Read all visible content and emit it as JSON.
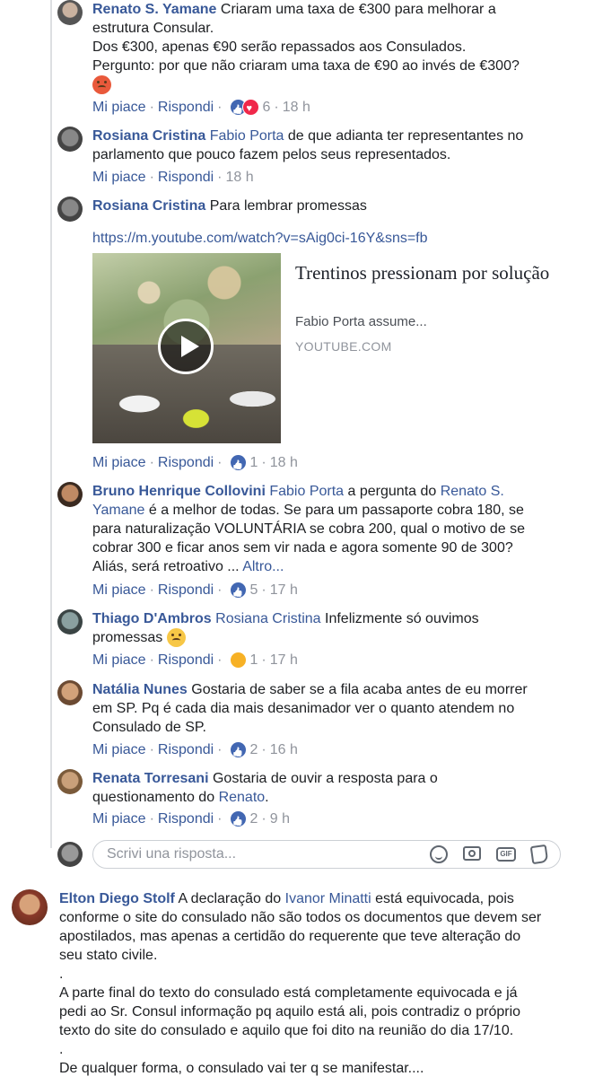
{
  "labels": {
    "like": "Mi piace",
    "reply": "Rispondi",
    "sep": "·"
  },
  "comments": [
    {
      "name": "Renato S. Yamane",
      "lines": [
        "Criaram uma taxa de €300 para melhorar a",
        "estrutura Consular.",
        "Dos €300, apenas €90 serão repassados aos Consulados.",
        "Pergunto: por que não criaram uma taxa de €90 ao invés de €300?"
      ],
      "count": "6",
      "time": "18 h"
    },
    {
      "name": "Rosiana Cristina",
      "mention": "Fabio Porta",
      "lines": [
        "de que adianta ter representantes no",
        "parlamento que pouco fazem pelos seus representados."
      ],
      "time": "18 h"
    },
    {
      "name": "Rosiana Cristina",
      "text": "Para lembrar promessas",
      "url": "https://m.youtube.com/watch?v=sAig0ci-16Y&sns=fb",
      "preview": {
        "title": "Trentinos pressionam por solução",
        "desc": "Fabio Porta assume...",
        "source": "YOUTUBE.COM"
      },
      "count": "1",
      "time": "18 h"
    },
    {
      "name": "Bruno Henrique Collovini",
      "mention": "Fabio Porta",
      "text1": "a pergunta do",
      "mention2": "Renato S.",
      "mention2b": "Yamane",
      "lines": [
        "é a melhor de todas. Se para um passaporte cobra 180, se",
        "para naturalização VOLUNTÁRIA se cobra 200, qual o motivo de se",
        "cobrar 300 e ficar anos sem vir nada e agora somente 90 de 300?",
        "Aliás, será retroativo ..."
      ],
      "more": "Altro...",
      "count": "5",
      "time": "17 h"
    },
    {
      "name": "Thiago D'Ambros",
      "mention": "Rosiana Cristina",
      "lines": [
        "Infelizmente só ouvimos",
        "promessas"
      ],
      "count": "1",
      "time": "17 h"
    },
    {
      "name": "Natália Nunes",
      "lines": [
        "Gostaria de saber se a fila acaba antes de eu morrer",
        "em SP. Pq é cada dia mais desanimador ver o quanto atendem no",
        "Consulado de SP."
      ],
      "count": "2",
      "time": "16 h"
    },
    {
      "name": "Renata Torresani",
      "lines": [
        "Gostaria de ouvir a resposta para o",
        "questionamento do"
      ],
      "mention": "Renato",
      "tail": ".",
      "count": "2",
      "time": "9 h"
    }
  ],
  "reply_box": {
    "placeholder": "Scrivi una risposta...",
    "gif": "GIF"
  },
  "top_comment": {
    "name": "Elton Diego Stolf",
    "lines": [
      "A declaração do",
      "está equivocada, pois",
      "conforme o site do consulado não são todos os documentos que devem ser",
      "apostilados, mas apenas a certidão do requerente que teve alteração do",
      "seu stato civile.",
      ".",
      "A parte final do texto do consulado está completamente equivocada e já",
      "pedi ao Sr. Consul informação pq aquilo está ali, pois contradiz o próprio",
      "texto do site do consulado e aquilo que foi dito na reunião do dia 17/10.",
      ".",
      "De qualquer forma, o consulado vai ter q se manifestar...."
    ],
    "mention": "Ivanor Minatti"
  },
  "colors": {
    "link": "#385898",
    "meta": "#90949c",
    "like": "#4267b2",
    "love": "#f0284a",
    "sad": "#f7b125"
  },
  "icons": [
    "angry-emoji-icon",
    "worried-emoji-icon",
    "like-reaction-icon",
    "love-reaction-icon",
    "sad-reaction-icon",
    "play-icon",
    "smiley-icon",
    "camera-icon",
    "gif-icon",
    "sticker-icon"
  ]
}
